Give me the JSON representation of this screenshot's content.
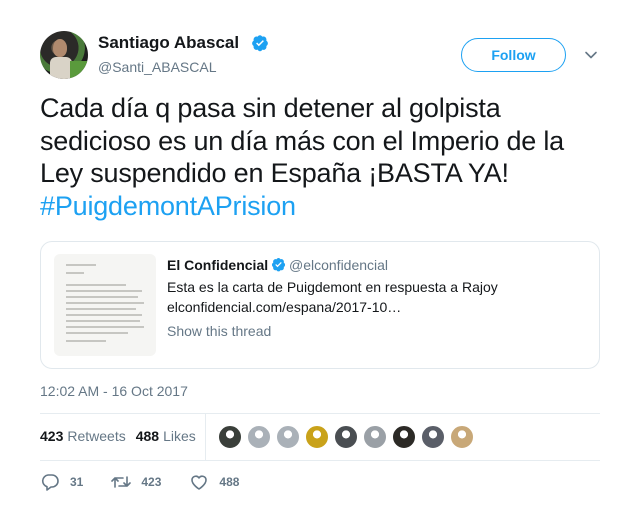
{
  "author": {
    "name": "Santiago Abascal",
    "handle": "@Santi_ABASCAL",
    "verified": true
  },
  "follow_label": "Follow",
  "tweet": {
    "text": "Cada día q pasa sin detener al golpista sedicioso es un día más con el Imperio de la Ley suspendido en España ¡BASTA YA! ",
    "hashtag": "#PuigdemontAPrision"
  },
  "quote": {
    "name": "El Confidencial",
    "handle": "@elconfidencial",
    "text": "Esta es la carta de Puigdemont en respuesta a Rajoy",
    "link": "elconfidencial.com/espana/2017-10…",
    "thread_label": "Show this thread"
  },
  "timestamp": "12:02 AM - 16 Oct 2017",
  "stats": {
    "retweets_count": "423",
    "retweets_label": "Retweets",
    "likes_count": "488",
    "likes_label": "Likes"
  },
  "liker_avatars": [
    "#3a3f3a",
    "#aab1b8",
    "#aab1b8",
    "#c9a21a",
    "#4a4e52",
    "#9aa0a6",
    "#2c2a26",
    "#5a5e68",
    "#c8a878"
  ],
  "actions": {
    "reply_count": "31",
    "retweet_count": "423",
    "like_count": "488"
  },
  "colors": {
    "accent": "#1da1f2",
    "secondary_text": "#657786",
    "primary_text": "#14171a"
  }
}
